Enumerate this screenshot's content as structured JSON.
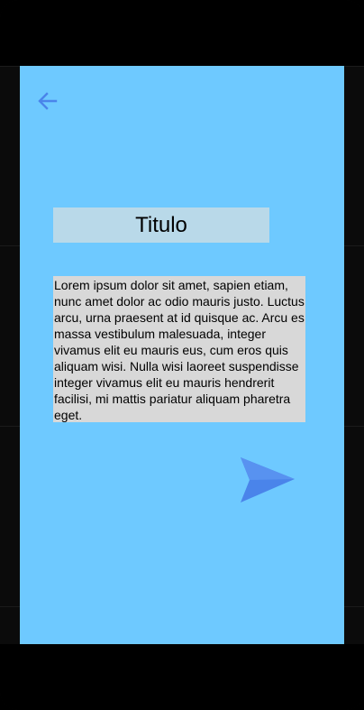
{
  "screen": {
    "title": "Titulo",
    "body_text": "Lorem ipsum dolor sit amet, sapien etiam, nunc amet dolor ac odio mauris justo. Luctus arcu, urna praesent at id quisque ac. Arcu es massa vestibulum malesuada, integer vivamus elit eu mauris eus, cum eros quis aliquam wisi. Nulla wisi laoreet suspendisse integer vivamus elit eu mauris hendrerit facilisi, mi mattis pariatur aliquam pharetra eget."
  },
  "icons": {
    "back": "arrow-left-icon",
    "send": "send-icon"
  },
  "colors": {
    "device_bezel": "#000000",
    "device_frame": "#0b0b0b",
    "screen_background": "#6ec9ff",
    "title_background": "#b9d9e9",
    "text_background": "#d8d8d8",
    "icon_blue": "#4a84ea"
  }
}
